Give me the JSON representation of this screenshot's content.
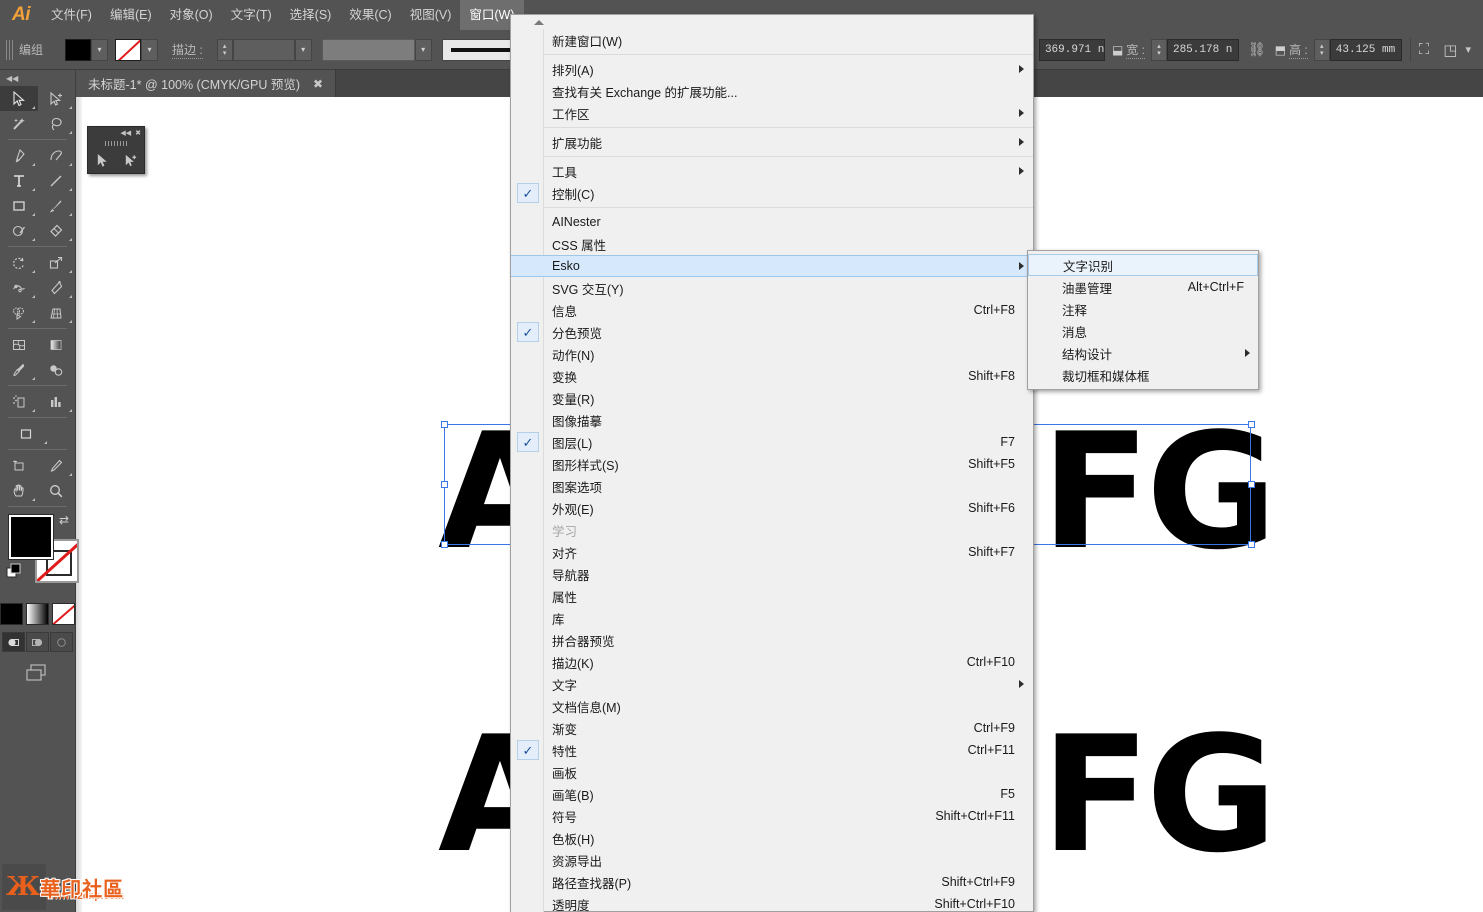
{
  "app": {
    "logo": "Ai"
  },
  "menubar": {
    "items": [
      {
        "label": "文件(F)",
        "active": false
      },
      {
        "label": "编辑(E)",
        "active": false
      },
      {
        "label": "对象(O)",
        "active": false
      },
      {
        "label": "文字(T)",
        "active": false
      },
      {
        "label": "选择(S)",
        "active": false
      },
      {
        "label": "效果(C)",
        "active": false
      },
      {
        "label": "视图(V)",
        "active": false
      },
      {
        "label": "窗口(W)",
        "active": true
      }
    ]
  },
  "controlbar": {
    "selection_label": "编组",
    "stroke_label": "描边 :",
    "fill_color": "#000000",
    "width_value": "369.971 n",
    "width_label": "宽 :",
    "height_value": "285.178 n",
    "height_label": "高 :",
    "depth_value": "43.125 mm"
  },
  "document": {
    "tab_title": "未标题-1* @ 100% (CMYK/GPU 预览)",
    "tab_close": "✖"
  },
  "toolbar": {
    "collapse": "◀◀",
    "tools": [
      {
        "name": "selection-tool",
        "selected": true
      },
      {
        "name": "direct-selection-tool",
        "selected": false
      },
      {
        "name": "magic-wand-tool",
        "selected": false
      },
      {
        "name": "lasso-tool",
        "selected": false
      },
      {
        "name": "pen-tool",
        "selected": false
      },
      {
        "name": "curvature-tool",
        "selected": false
      },
      {
        "name": "type-tool",
        "selected": false
      },
      {
        "name": "line-segment-tool",
        "selected": false
      },
      {
        "name": "rectangle-tool",
        "selected": false
      },
      {
        "name": "paintbrush-tool",
        "selected": false
      },
      {
        "name": "shaper-tool",
        "selected": false
      },
      {
        "name": "eraser-tool",
        "selected": false
      },
      {
        "name": "rotate-tool",
        "selected": false
      },
      {
        "name": "scale-tool",
        "selected": false
      },
      {
        "name": "width-tool",
        "selected": false
      },
      {
        "name": "free-transform-tool",
        "selected": false
      },
      {
        "name": "shape-builder-tool",
        "selected": false
      },
      {
        "name": "perspective-grid-tool",
        "selected": false
      },
      {
        "name": "mesh-tool",
        "selected": false
      },
      {
        "name": "gradient-tool",
        "selected": false
      },
      {
        "name": "eyedropper-tool",
        "selected": false
      },
      {
        "name": "blend-tool",
        "selected": false
      },
      {
        "name": "symbol-sprayer-tool",
        "selected": false
      },
      {
        "name": "column-graph-tool",
        "selected": false
      },
      {
        "name": "artboard-tool",
        "selected": false
      },
      {
        "name": "slice-tool",
        "selected": false
      },
      {
        "name": "hand-tool",
        "selected": false
      },
      {
        "name": "zoom-tool",
        "selected": false
      }
    ],
    "fill_color": "#000000",
    "stroke_color": "#ffffff",
    "color_modes": [
      {
        "name": "color-mode-flat",
        "type": "black"
      },
      {
        "name": "color-mode-gradient",
        "type": "grad"
      },
      {
        "name": "color-mode-none",
        "type": "none"
      }
    ],
    "draw_modes": [
      {
        "name": "draw-normal-mode",
        "selected": true
      },
      {
        "name": "draw-behind-mode",
        "selected": false
      },
      {
        "name": "draw-inside-mode",
        "selected": false
      }
    ]
  },
  "float_panel": {
    "collapse": "◀◀",
    "close": "✖"
  },
  "window_menu": {
    "items": [
      {
        "label": "新建窗口(W)",
        "accel": "",
        "arrow": false,
        "check": false
      },
      {
        "sep": true
      },
      {
        "label": "排列(A)",
        "accel": "",
        "arrow": true,
        "check": false
      },
      {
        "label": "查找有关 Exchange 的扩展功能...",
        "accel": "",
        "arrow": false,
        "check": false
      },
      {
        "label": "工作区",
        "accel": "",
        "arrow": true,
        "check": false
      },
      {
        "sep": true
      },
      {
        "label": "扩展功能",
        "accel": "",
        "arrow": true,
        "check": false
      },
      {
        "sep": true
      },
      {
        "label": "工具",
        "accel": "",
        "arrow": true,
        "check": false
      },
      {
        "label": "控制(C)",
        "accel": "",
        "arrow": false,
        "check": true
      },
      {
        "sep": true
      },
      {
        "label": "AINester",
        "accel": "",
        "arrow": false,
        "check": false
      },
      {
        "label": "CSS 属性",
        "accel": "",
        "arrow": false,
        "check": false
      },
      {
        "label": "Esko",
        "accel": "",
        "arrow": true,
        "check": false,
        "highlight": true
      },
      {
        "label": "SVG 交互(Y)",
        "accel": "",
        "arrow": false,
        "check": false
      },
      {
        "label": "信息",
        "accel": "Ctrl+F8",
        "arrow": false,
        "check": false
      },
      {
        "label": "分色预览",
        "accel": "",
        "arrow": false,
        "check": true
      },
      {
        "label": "动作(N)",
        "accel": "",
        "arrow": false,
        "check": false
      },
      {
        "label": "变换",
        "accel": "Shift+F8",
        "arrow": false,
        "check": false
      },
      {
        "label": "变量(R)",
        "accel": "",
        "arrow": false,
        "check": false
      },
      {
        "label": "图像描摹",
        "accel": "",
        "arrow": false,
        "check": false
      },
      {
        "label": "图层(L)",
        "accel": "F7",
        "arrow": false,
        "check": true
      },
      {
        "label": "图形样式(S)",
        "accel": "Shift+F5",
        "arrow": false,
        "check": false
      },
      {
        "label": "图案选项",
        "accel": "",
        "arrow": false,
        "check": false
      },
      {
        "label": "外观(E)",
        "accel": "Shift+F6",
        "arrow": false,
        "check": false
      },
      {
        "label": "学习",
        "accel": "",
        "arrow": false,
        "check": false,
        "disabled": true
      },
      {
        "label": "对齐",
        "accel": "Shift+F7",
        "arrow": false,
        "check": false
      },
      {
        "label": "导航器",
        "accel": "",
        "arrow": false,
        "check": false
      },
      {
        "label": "属性",
        "accel": "",
        "arrow": false,
        "check": false
      },
      {
        "label": "库",
        "accel": "",
        "arrow": false,
        "check": false
      },
      {
        "label": "拼合器预览",
        "accel": "",
        "arrow": false,
        "check": false
      },
      {
        "label": "描边(K)",
        "accel": "Ctrl+F10",
        "arrow": false,
        "check": false
      },
      {
        "label": "文字",
        "accel": "",
        "arrow": true,
        "check": false
      },
      {
        "label": "文档信息(M)",
        "accel": "",
        "arrow": false,
        "check": false
      },
      {
        "label": "渐变",
        "accel": "Ctrl+F9",
        "arrow": false,
        "check": false
      },
      {
        "label": "特性",
        "accel": "Ctrl+F11",
        "arrow": false,
        "check": true
      },
      {
        "label": "画板",
        "accel": "",
        "arrow": false,
        "check": false
      },
      {
        "label": "画笔(B)",
        "accel": "F5",
        "arrow": false,
        "check": false
      },
      {
        "label": "符号",
        "accel": "Shift+Ctrl+F11",
        "arrow": false,
        "check": false
      },
      {
        "label": "色板(H)",
        "accel": "",
        "arrow": false,
        "check": false
      },
      {
        "label": "资源导出",
        "accel": "",
        "arrow": false,
        "check": false
      },
      {
        "label": "路径查找器(P)",
        "accel": "Shift+Ctrl+F9",
        "arrow": false,
        "check": false
      },
      {
        "label": "透明度",
        "accel": "Shift+Ctrl+F10",
        "arrow": false,
        "check": false
      }
    ]
  },
  "esko_submenu": {
    "items": [
      {
        "label": "文字识别",
        "accel": "",
        "arrow": false,
        "highlight": true
      },
      {
        "label": "油墨管理",
        "accel": "Alt+Ctrl+F",
        "arrow": false
      },
      {
        "label": "注释",
        "accel": "",
        "arrow": false
      },
      {
        "label": "消息",
        "accel": "",
        "arrow": false
      },
      {
        "label": "结构设计",
        "accel": "",
        "arrow": true
      },
      {
        "label": "裁切框和媒体框",
        "accel": "",
        "arrow": false
      }
    ]
  },
  "canvas": {
    "objects": [
      {
        "name": "letter-A-top",
        "text": "A"
      },
      {
        "name": "letter-F-top",
        "text": "F"
      },
      {
        "name": "letter-G-top",
        "text": "G"
      },
      {
        "name": "letter-A-bottom",
        "text": "A"
      },
      {
        "name": "letter-F-bottom",
        "text": "F"
      },
      {
        "name": "letter-G-bottom",
        "text": "G"
      }
    ]
  },
  "watermark": {
    "mark": "Ж",
    "text": "華印社區",
    "url": "www.52cnp.com"
  },
  "colors": {
    "chrome_bg": "#535353",
    "menu_bg": "#f0f0f0",
    "accent_blue": "#3a76e8",
    "highlight": "#d6e8fb",
    "logo_orange": "#f2a13a"
  }
}
